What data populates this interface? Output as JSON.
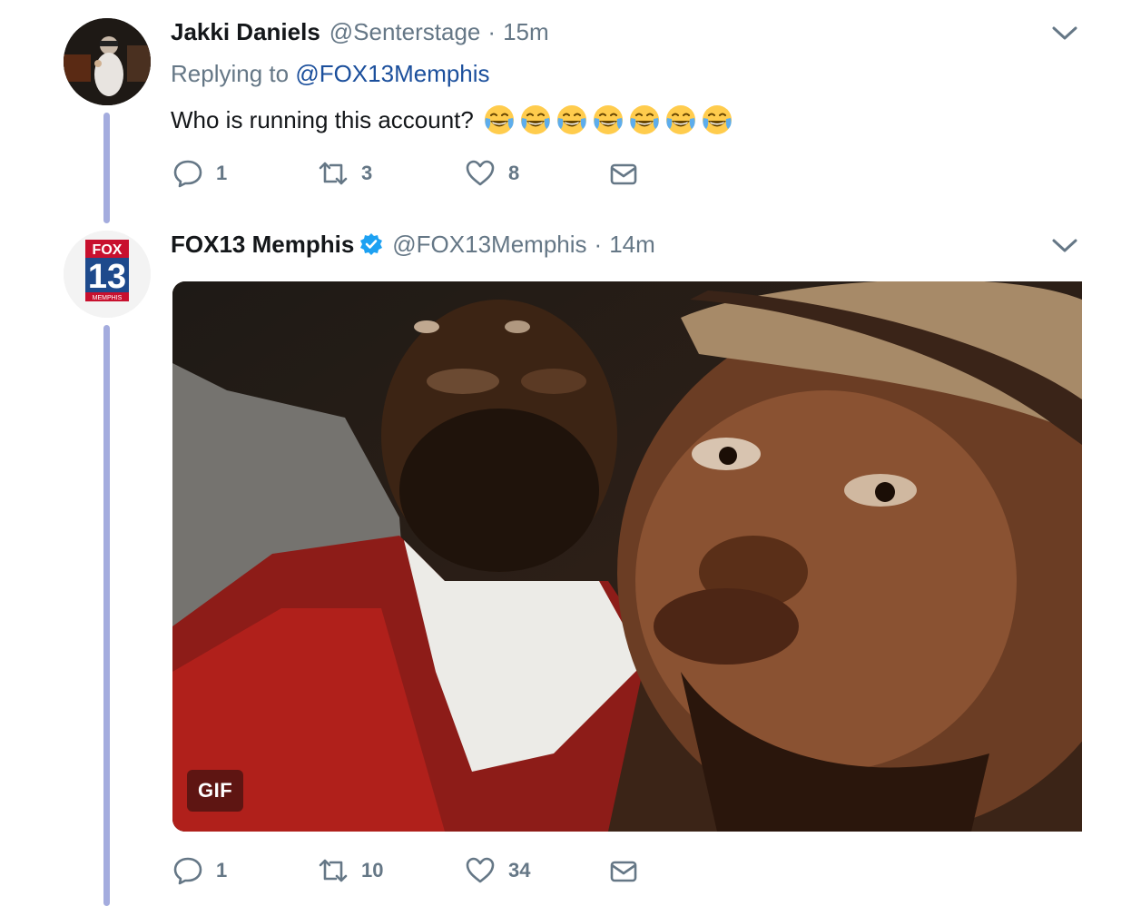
{
  "tweets": [
    {
      "name": "Jakki Daniels",
      "handle": "@Senterstage",
      "dot": "·",
      "time": "15m",
      "replying_prefix": "Replying to",
      "replying_to": "@FOX13Memphis",
      "text": "Who is running this account?",
      "emojis": [
        "face-with-tears-of-joy",
        "face-with-tears-of-joy",
        "face-with-tears-of-joy",
        "face-with-tears-of-joy",
        "face-with-tears-of-joy",
        "face-with-tears-of-joy",
        "face-with-tears-of-joy"
      ],
      "reply_count": "1",
      "retweet_count": "3",
      "like_count": "8"
    },
    {
      "name": "FOX13 Memphis",
      "verified": true,
      "handle": "@FOX13Memphis",
      "dot": "·",
      "time": "14m",
      "avatar_text": {
        "top": "FOX",
        "number": "13",
        "bottom": "MEMPHIS"
      },
      "media_badge": "GIF",
      "reply_count": "1",
      "retweet_count": "10",
      "like_count": "34"
    }
  ],
  "colors": {
    "thread_line": "#a4acde",
    "link": "#1b4f9c",
    "muted": "#657786",
    "verified": "#1da1f2",
    "fox_red": "#c8102e"
  }
}
